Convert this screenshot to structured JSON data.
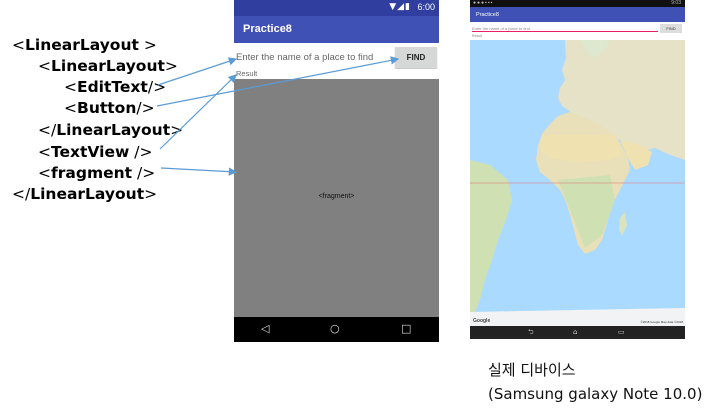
{
  "xml_tree": [
    {
      "open": "<",
      "tag": "LinearLayout",
      "close": " >"
    },
    {
      "open": "<",
      "tag": "LinearLayout",
      "close": ">"
    },
    {
      "open": "<",
      "tag": "EditText",
      "close": "/>"
    },
    {
      "open": "<",
      "tag": "Button",
      "close": "/>"
    },
    {
      "open": "</",
      "tag": "LinearLayout",
      "close": ">"
    },
    {
      "open": "<",
      "tag": "TextView",
      "close": "  />"
    },
    {
      "open": "<",
      "tag": "fragment",
      "close": "  />"
    },
    {
      "open": "</",
      "tag": "LinearLayout",
      "close": ">"
    }
  ],
  "emulator": {
    "status_time": "6:00",
    "status_icons": "wifi-icon signal-icon battery-icon",
    "app_title": "Practice8",
    "edit_placeholder": "Enter the name of a place to find",
    "find_button": "FIND",
    "result_label": "Result",
    "fragment_label": "<fragment>",
    "nav_back": "◁",
    "nav_home": "○",
    "nav_recent": "□"
  },
  "device": {
    "status_time": "9:03",
    "app_title": "Practice8",
    "edit_placeholder": "Enter the name of a place to find",
    "find_button": "FIND",
    "result_label": "Result",
    "map_logo": "Google",
    "map_attribution": "©2018 Google  Map data ©2018",
    "nav_back": "⮌",
    "nav_home": "⌂",
    "nav_recent": "▭"
  },
  "caption": {
    "line1": "실제 디바이스",
    "line2": "(Samsung galaxy Note 10.0)"
  },
  "colors": {
    "primary": "#3f51b5",
    "primary_dark": "#303f9f",
    "arrow": "#5b9bd5",
    "fragment_gray": "#808080",
    "ocean": "#aadaff"
  }
}
